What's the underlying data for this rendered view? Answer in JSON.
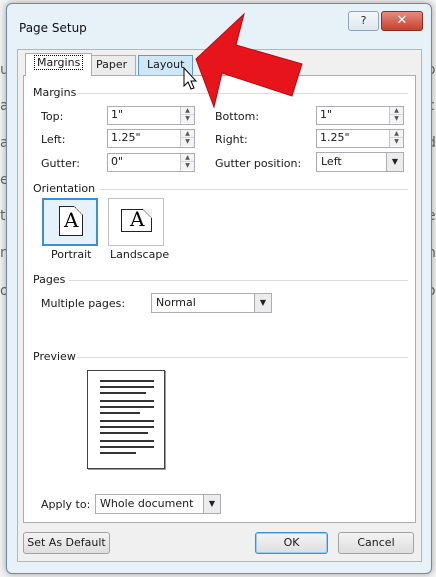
{
  "dialog": {
    "title": "Page Setup",
    "help_label": "?",
    "close_label": "✕"
  },
  "tabs": [
    {
      "label": "Margins"
    },
    {
      "label": "Paper"
    },
    {
      "label": "Layout"
    }
  ],
  "margins": {
    "section_label": "Margins",
    "top": {
      "label": "Top:",
      "value": "1\""
    },
    "bottom": {
      "label": "Bottom:",
      "value": "1\""
    },
    "left": {
      "label": "Left:",
      "value": "1.25\""
    },
    "right": {
      "label": "Right:",
      "value": "1.25\""
    },
    "gutter": {
      "label": "Gutter:",
      "value": "0\""
    },
    "gutter_position": {
      "label": "Gutter position:",
      "value": "Left"
    }
  },
  "orientation": {
    "section_label": "Orientation",
    "portrait_label": "Portrait",
    "landscape_label": "Landscape",
    "icon_letter": "A"
  },
  "pages": {
    "section_label": "Pages",
    "multiple_pages_label": "Multiple pages:",
    "multiple_pages_value": "Normal"
  },
  "preview": {
    "section_label": "Preview"
  },
  "apply_to": {
    "label": "Apply to:",
    "value": "Whole document"
  },
  "buttons": {
    "set_default": "Set As Default",
    "ok": "OK",
    "cancel": "Cancel"
  },
  "background_letters": [
    "u",
    "a",
    "a",
    "e",
    "t",
    "n",
    "o",
    "o",
    "c",
    "d",
    "e",
    "n",
    "o"
  ],
  "colors": {
    "arrow": "#e8141c",
    "selection": "#3d8ed8"
  }
}
